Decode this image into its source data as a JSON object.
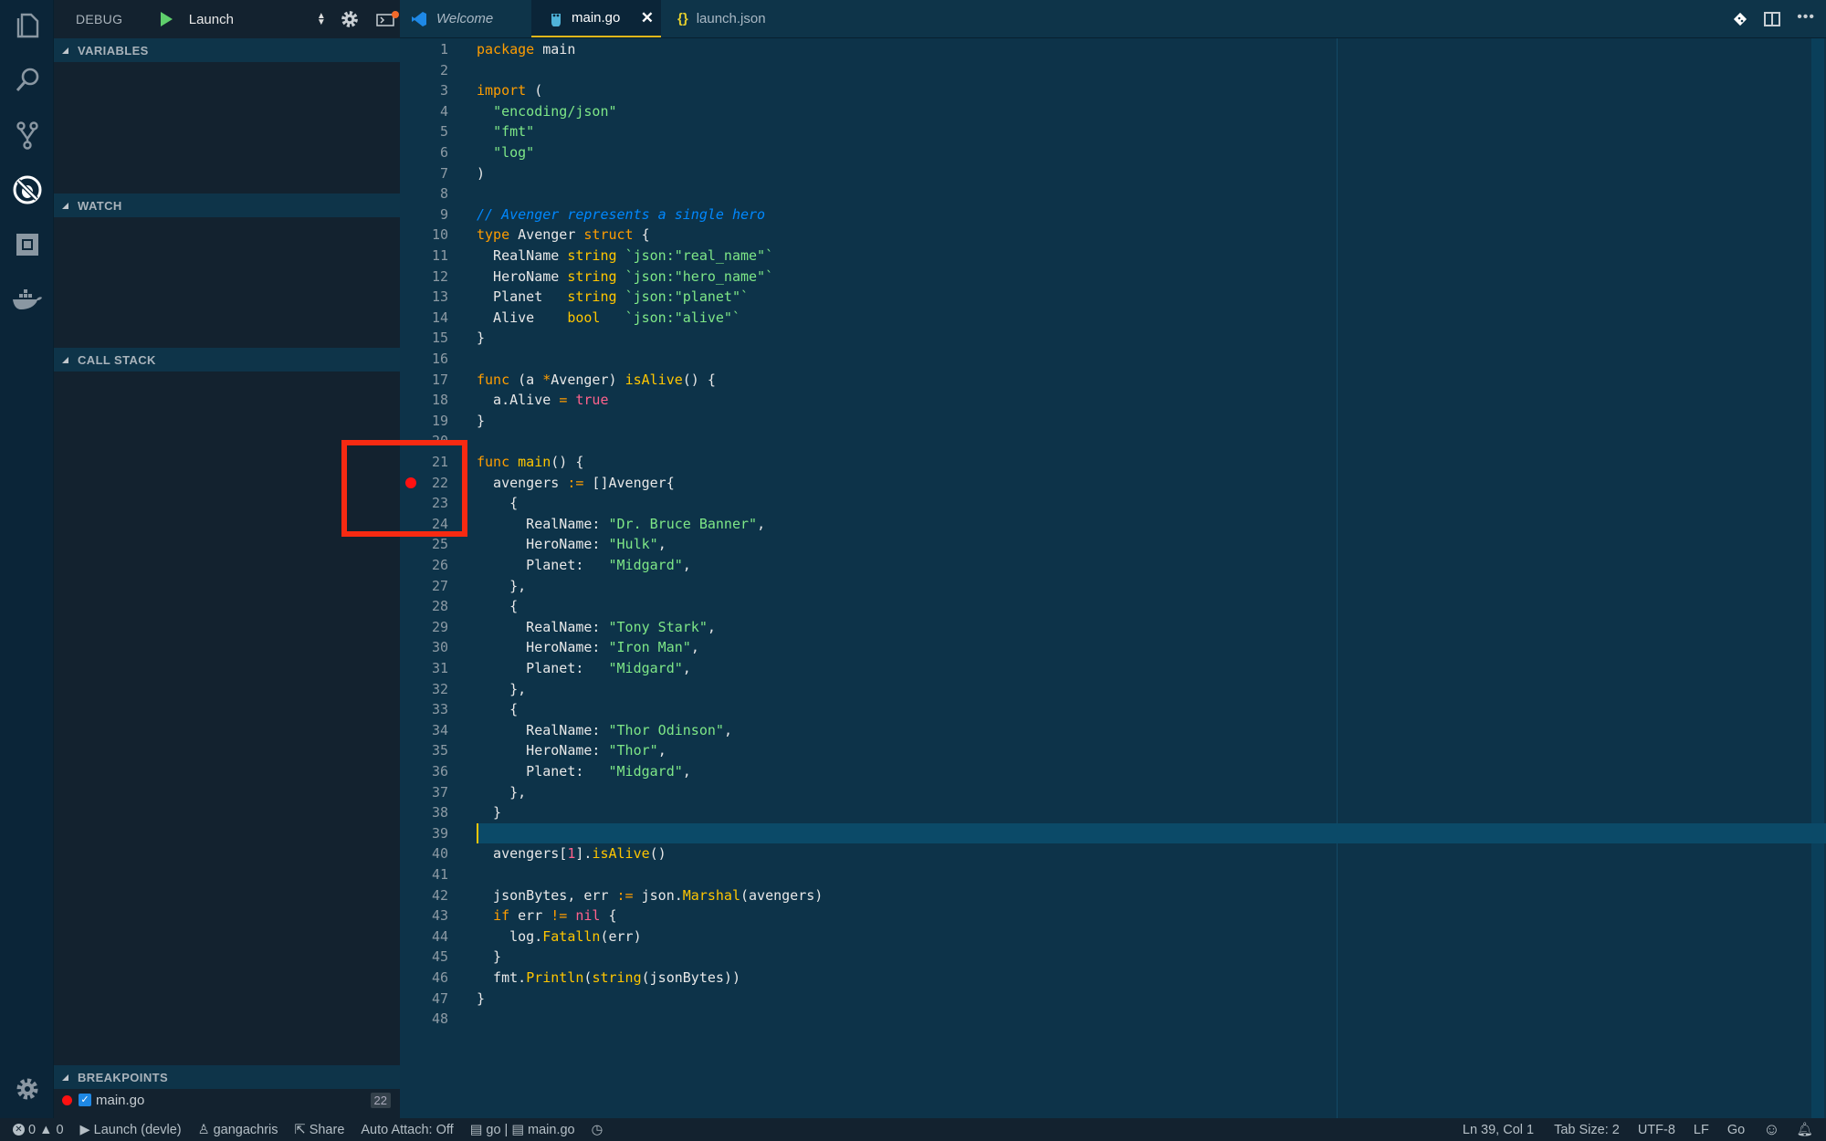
{
  "activity_bar": {
    "items": [
      "explorer",
      "search",
      "source-control",
      "debug",
      "extensions",
      "docker"
    ],
    "settings": "settings"
  },
  "debug_toolbar": {
    "title": "DEBUG",
    "configuration": "Launch"
  },
  "sections": {
    "variables": "VARIABLES",
    "watch": "WATCH",
    "call_stack": "CALL STACK",
    "breakpoints": "BREAKPOINTS"
  },
  "breakpoints": [
    {
      "file": "main.go",
      "line": "22",
      "enabled": true
    }
  ],
  "tabs": [
    {
      "label": "Welcome",
      "icon": "vscode-icon"
    },
    {
      "label": "main.go",
      "icon": "gopher-icon",
      "active": true
    },
    {
      "label": "launch.json",
      "icon": "json-icon"
    }
  ],
  "editor": {
    "breakpoint_line": 22,
    "cursor_line": 39,
    "lines": [
      "package main",
      "",
      "import (",
      "  \"encoding/json\"",
      "  \"fmt\"",
      "  \"log\"",
      ")",
      "",
      "// Avenger represents a single hero",
      "type Avenger struct {",
      "  RealName string `json:\"real_name\"`",
      "  HeroName string `json:\"hero_name\"`",
      "  Planet   string `json:\"planet\"`",
      "  Alive    bool   `json:\"alive\"`",
      "}",
      "",
      "func (a *Avenger) isAlive() {",
      "  a.Alive = true",
      "}",
      "",
      "func main() {",
      "  avengers := []Avenger{",
      "    {",
      "      RealName: \"Dr. Bruce Banner\",",
      "      HeroName: \"Hulk\",",
      "      Planet:   \"Midgard\",",
      "    },",
      "    {",
      "      RealName: \"Tony Stark\",",
      "      HeroName: \"Iron Man\",",
      "      Planet:   \"Midgard\",",
      "    },",
      "    {",
      "      RealName: \"Thor Odinson\",",
      "      HeroName: \"Thor\",",
      "      Planet:   \"Midgard\",",
      "    },",
      "  }",
      "",
      "  avengers[1].isAlive()",
      "",
      "  jsonBytes, err := json.Marshal(avengers)",
      "  if err != nil {",
      "    log.Fatalln(err)",
      "  }",
      "  fmt.Println(string(jsonBytes))",
      "}",
      ""
    ]
  },
  "status": {
    "errors": "0",
    "warnings": "0",
    "debug": "Launch (devle)",
    "user": "gangachris",
    "share": "Share",
    "auto_attach": "Auto Attach: Off",
    "go_info": "go | ",
    "file": "main.go",
    "position": "Ln 39, Col 1",
    "tab_size": "Tab Size: 2",
    "encoding": "UTF-8",
    "eol": "LF",
    "language": "Go"
  }
}
